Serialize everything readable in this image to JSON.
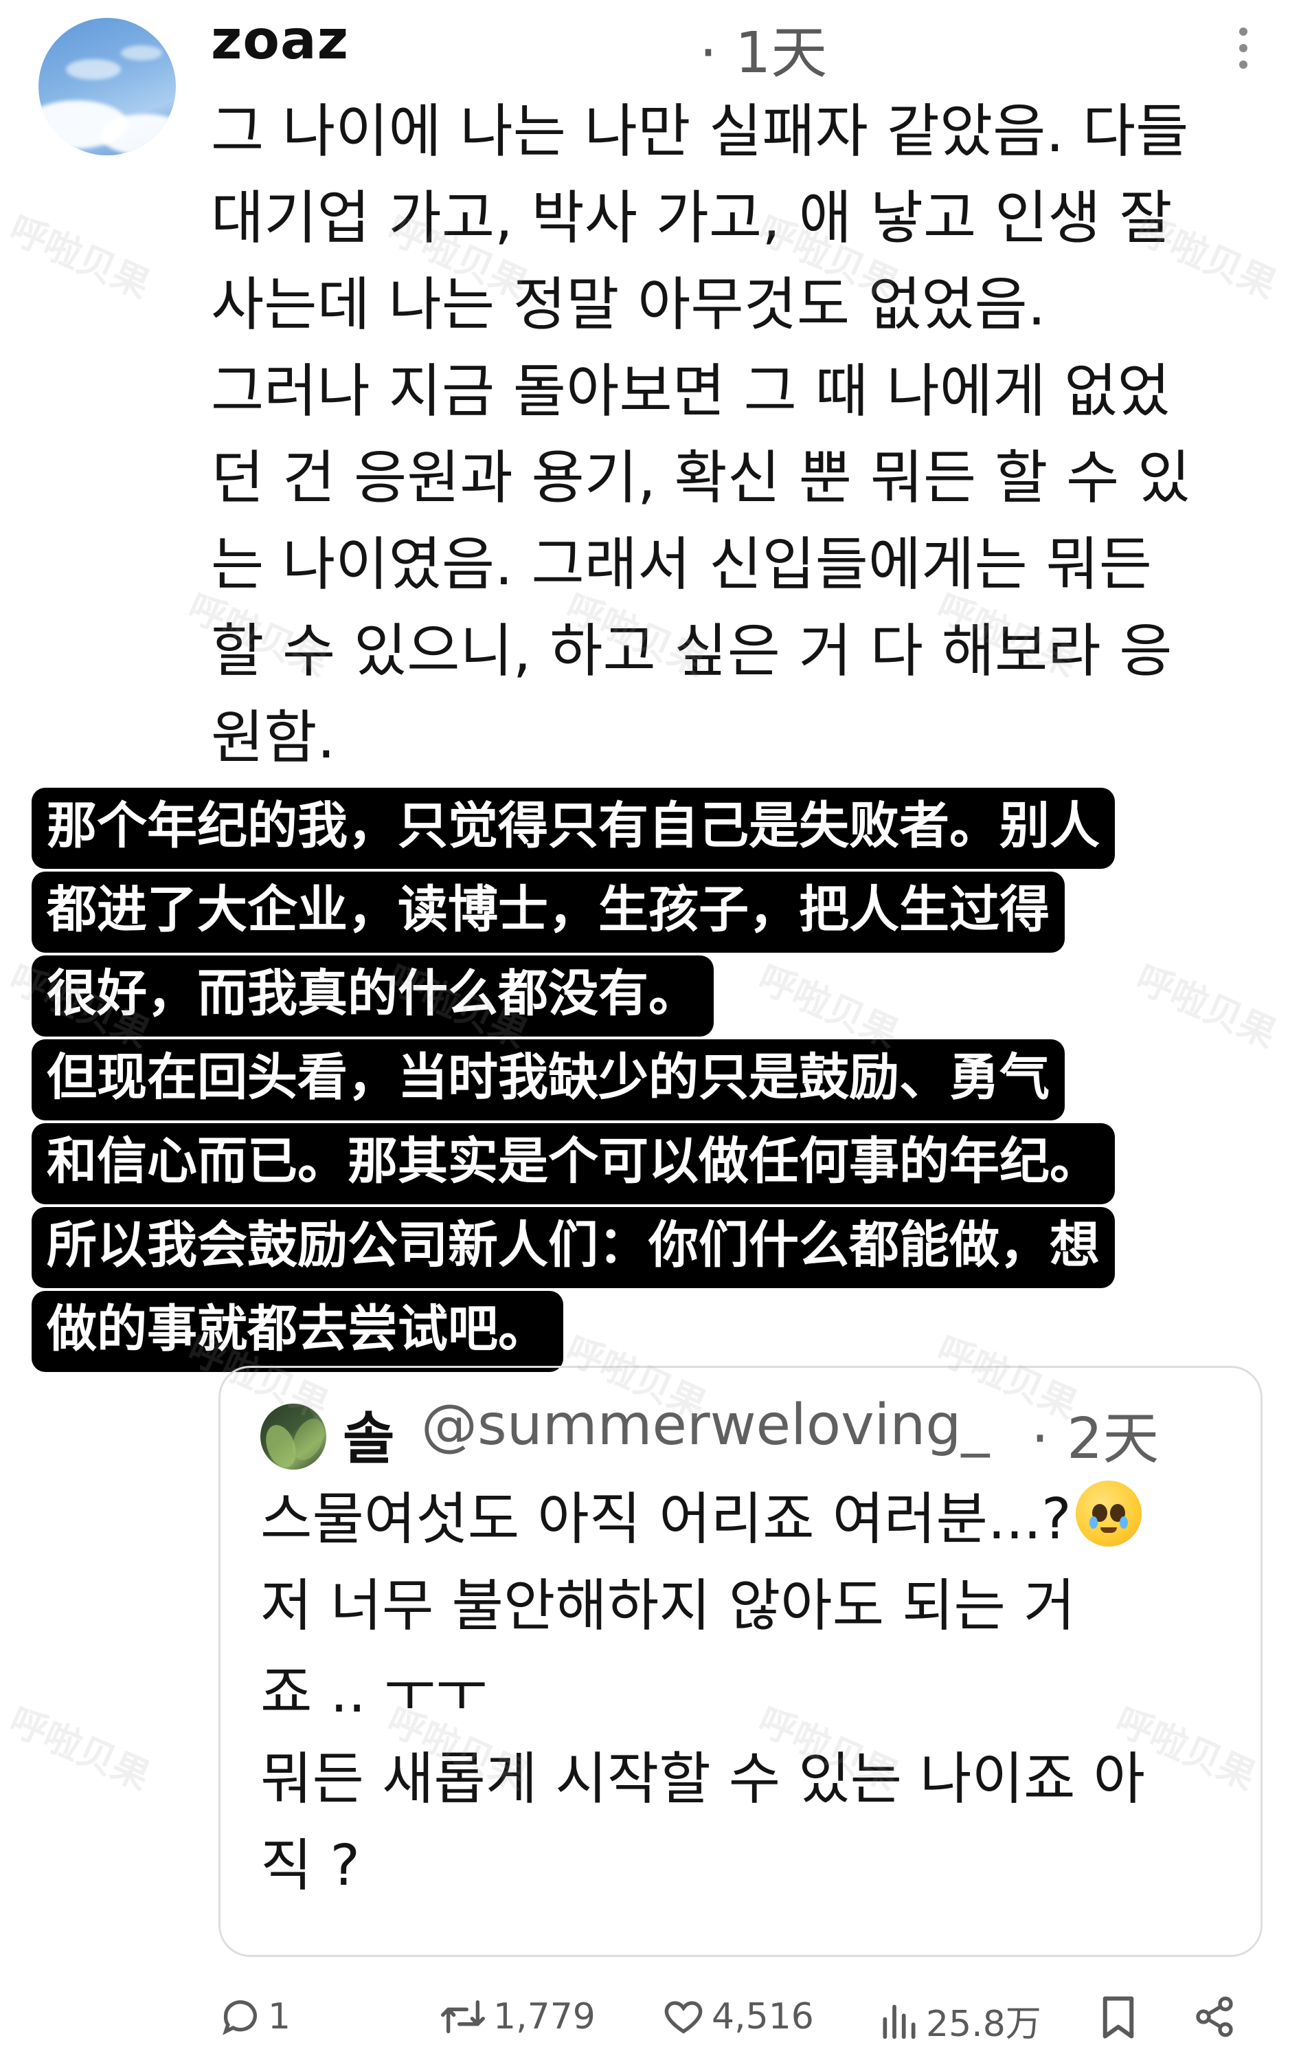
{
  "tweet": {
    "username": "zoaz",
    "time": "· 1天",
    "text_lines": [
      "그 나이에 나는 나만 실패자 같았음. 다들",
      "대기업 가고, 박사 가고, 애 낳고 인생 잘",
      "사는데 나는 정말 아무것도 없었음.",
      "그러나 지금 돌아보면 그 때 나에게 없었",
      "던 건 응원과 용기, 확신 뿐 뭐든 할 수 있",
      "는 나이였음. 그래서 신입들에게는 뭐든",
      "할 수 있으니, 하고 싶은 거 다 해보라 응",
      "원함."
    ]
  },
  "translation_lines": [
    "那个年纪的我，只觉得只有自己是失败者。别人",
    "都进了大企业，读博士，生孩子，把人生过得",
    "很好，而我真的什么都没有。",
    "但现在回头看，当时我缺少的只是鼓励、勇气",
    "和信心而已。那其实是个可以做任何事的年纪。",
    "所以我会鼓励公司新人们：你们什么都能做，想",
    "做的事就都去尝试吧。"
  ],
  "quote": {
    "name": "솔",
    "handle": "@summerweloving_",
    "time": "· 2天",
    "text_lines": [
      "스물여섯도 아직 어리죠 여러분...?",
      "저 너무 불안해하지 않아도 되는 거",
      "죠 .. ㅜㅜ",
      "뭐든 새롭게 시작할 수 있는 나이죠 아",
      "직 ?"
    ],
    "emoji": "crying-face-emoji"
  },
  "actions": {
    "reply_count": "1",
    "repost_count": "1,779",
    "like_count": "4,516",
    "views_count": "25.8万"
  },
  "watermark": "呼啦贝果",
  "colors": {
    "background": "#ffffff",
    "text": "#111111",
    "muted": "#5a5a5a",
    "highlight_bg": "#000000",
    "highlight_text": "#ffffff"
  }
}
